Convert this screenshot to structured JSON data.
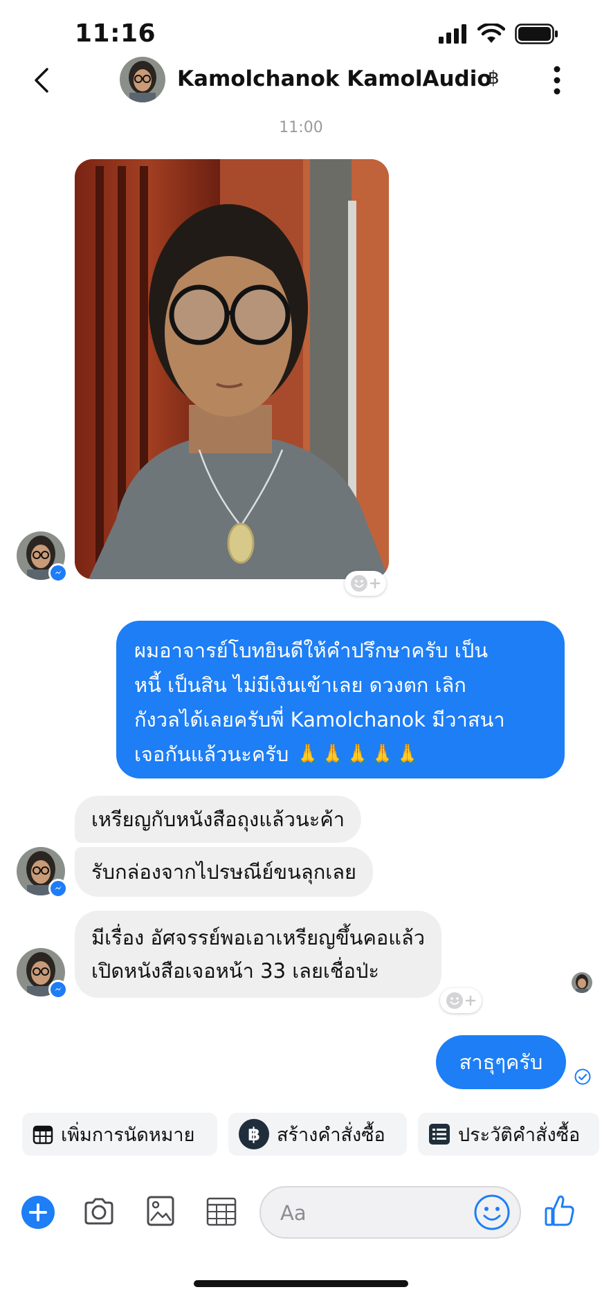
{
  "status_bar": {
    "time": "11:16"
  },
  "header": {
    "contact_name": "Kamolchanok KamolAudio",
    "badge": "฿"
  },
  "conversation": {
    "timestamp": "11:00",
    "outgoing_advice": {
      "lines": [
        "ผมอาจารย์โบทยินดีให้คำปรึกษาครับ เป็น",
        "หนี้ เป็นสิน ไม่มีเงินเข้าเลย ดวงตก เลิก",
        "กังวลได้เลยครับพี่ Kamolchanok  มีวาสนา",
        "เจอกันแล้วนะครับ 🙏🙏🙏🙏🙏"
      ]
    },
    "incoming": [
      {
        "lines": [
          "เหรียญกับหนังสือถุงแล้วนะค้า"
        ]
      },
      {
        "lines": [
          "รับกล่องจากไปรษณีย์ขนลุกเลย"
        ]
      },
      {
        "lines": [
          "มีเรื่อง อัศจรรย์พอเอาเหรียญขึ้นคอแล้ว",
          "เปิดหนังสือเจอหน้า 33 เลยเชื่อป่ะ"
        ]
      }
    ],
    "outgoing_reply": "สาธุๆครับ"
  },
  "quick_actions": [
    {
      "label": "เพิ่มการนัดหมาย",
      "icon": "calendar-icon"
    },
    {
      "label": "สร้างคำสั่งซื้อ",
      "icon": "baht-icon"
    },
    {
      "label": "ประวัติคำสั่งซื้อ",
      "icon": "order-list-icon"
    }
  ],
  "composer": {
    "placeholder": "Aa"
  },
  "colors": {
    "accent": "#1d7ef5",
    "bubble_incoming": "#efefef",
    "chip_bg": "#f3f4f6"
  }
}
